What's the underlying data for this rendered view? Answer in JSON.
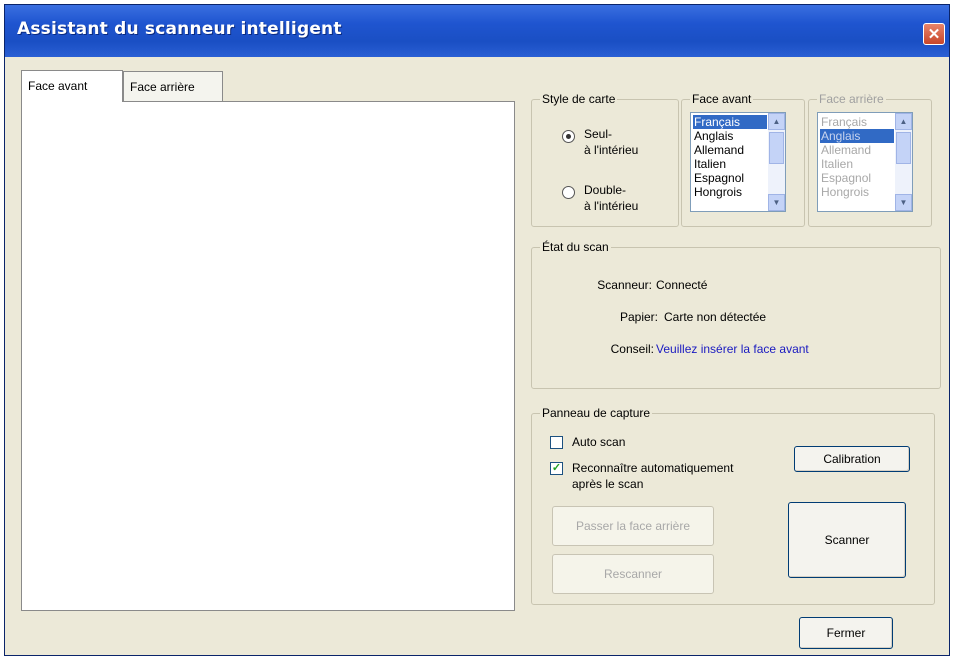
{
  "window": {
    "title": "Assistant du scanneur intelligent",
    "close_glyph": "✕"
  },
  "tabs": [
    {
      "label": "Face avant",
      "active": true
    },
    {
      "label": "Face arrière",
      "active": false
    }
  ],
  "card_style": {
    "legend": "Style de carte",
    "options": [
      {
        "line1": "Seul-",
        "line2": "à l'intérieu",
        "checked": true
      },
      {
        "line1": "Double-",
        "line2": "à l'intérieu",
        "checked": false
      }
    ]
  },
  "front_lang": {
    "legend": "Face avant",
    "items": [
      "Français",
      "Anglais",
      "Allemand",
      "Italien",
      "Espagnol",
      "Hongrois"
    ],
    "selected": "Français"
  },
  "back_lang": {
    "legend": "Face arrière",
    "items": [
      "Français",
      "Anglais",
      "Allemand",
      "Italien",
      "Espagnol",
      "Hongrois"
    ],
    "selected": "Anglais",
    "disabled": true
  },
  "scan_status": {
    "legend": "État du scan",
    "scanner_label": "Scanneur:",
    "scanner_value": "Connecté",
    "paper_label": "Papier:",
    "paper_value": "Carte non détectée",
    "advice_label": "Conseil:",
    "advice_value": "Veuillez insérer la face avant",
    "advice_color": "#1a1ac0"
  },
  "capture": {
    "legend": "Panneau de capture",
    "auto_scan_label": "Auto scan",
    "auto_scan_checked": false,
    "auto_recognize_label_1": "Reconnaître automatiquement",
    "auto_recognize_label_2": "après le scan",
    "auto_recognize_checked": true,
    "calibration_label": "Calibration",
    "scan_back_label": "Passer la face arrière",
    "rescan_label": "Rescanner",
    "scan_label": "Scanner"
  },
  "close_label": "Fermer",
  "colors": {
    "title_bar": "#1f55d0",
    "window_bg": "#ece9d8",
    "selection": "#316ac5"
  }
}
